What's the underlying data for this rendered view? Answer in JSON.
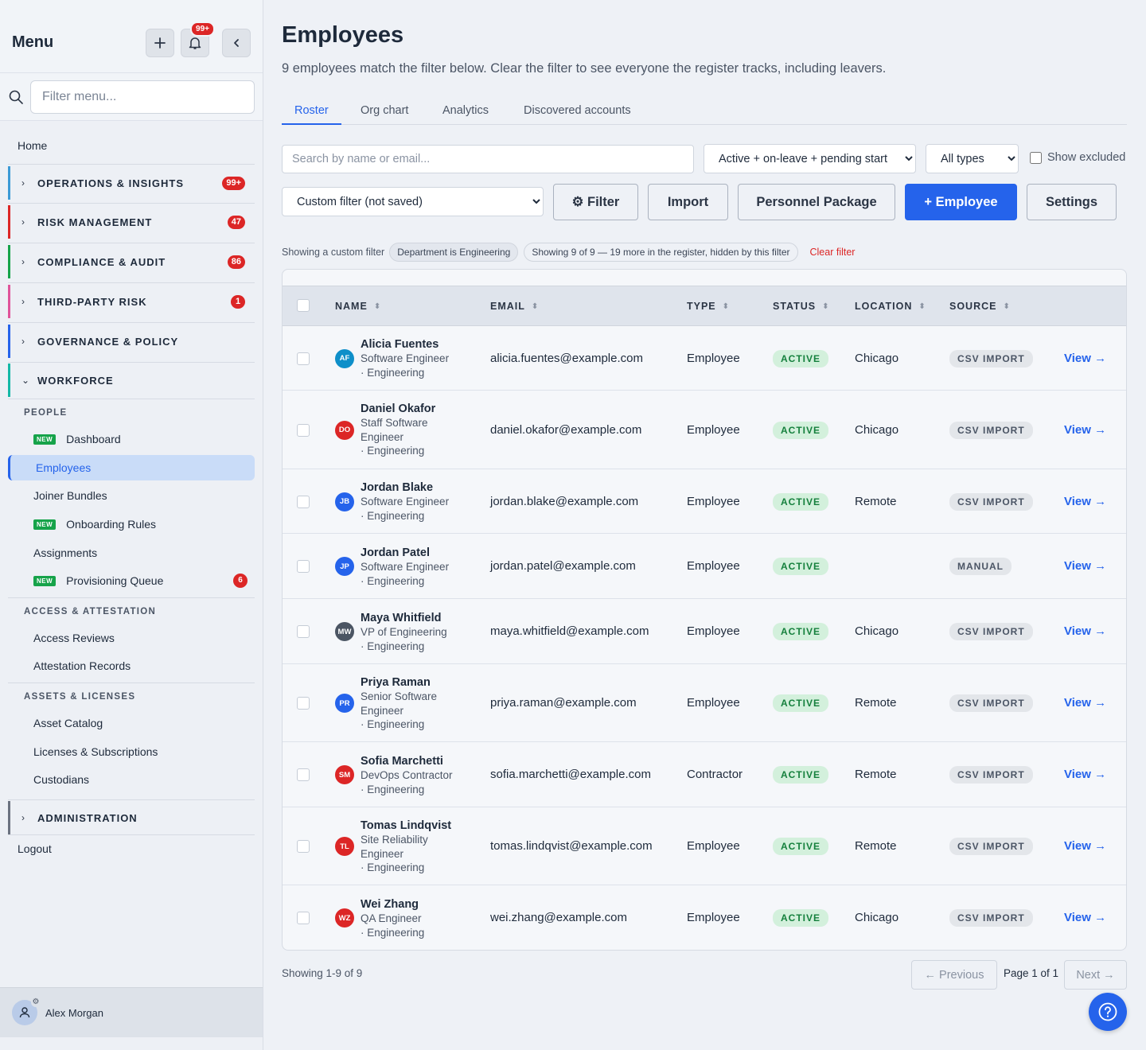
{
  "sidebar": {
    "title": "Menu",
    "notif_count": "99+",
    "search_placeholder": "Filter menu...",
    "home": "Home",
    "sections": [
      {
        "label": "OPERATIONS & INSIGHTS",
        "count": "99+",
        "color": "#3b9ad6"
      },
      {
        "label": "RISK MANAGEMENT",
        "count": "47",
        "color": "#dc2626"
      },
      {
        "label": "COMPLIANCE & AUDIT",
        "count": "86",
        "color": "#16a34a"
      },
      {
        "label": "THIRD-PARTY RISK",
        "count": "1",
        "color": "#e0549a"
      },
      {
        "label": "GOVERNANCE & POLICY",
        "count": "",
        "color": "#2563eb"
      },
      {
        "label": "WORKFORCE",
        "count": "",
        "color": "#14b8a6"
      },
      {
        "label": "ADMINISTRATION",
        "count": "",
        "color": "#6b7280"
      }
    ],
    "groups": {
      "people": "PEOPLE",
      "access": "ACCESS & ATTESTATION",
      "assets": "ASSETS & LICENSES"
    },
    "new_badge": "NEW",
    "items": {
      "dashboard": "Dashboard",
      "employees": "Employees",
      "joiner_bundles": "Joiner Bundles",
      "onboarding_rules": "Onboarding Rules",
      "assignments": "Assignments",
      "provisioning_queue": "Provisioning Queue",
      "provisioning_count": "6",
      "access_reviews": "Access Reviews",
      "attestation_records": "Attestation Records",
      "asset_catalog": "Asset Catalog",
      "licenses": "Licenses & Subscriptions",
      "custodians": "Custodians"
    },
    "logout": "Logout",
    "user_name": "Alex Morgan"
  },
  "main": {
    "title": "Employees",
    "subtitle": "9 employees match the filter below. Clear the filter to see everyone the register tracks, including leavers.",
    "tabs": [
      "Roster",
      "Org chart",
      "Analytics",
      "Discovered accounts"
    ],
    "search_placeholder": "Search by name or email...",
    "status_filter": "Active + on-leave + pending start",
    "type_filter": "All types",
    "show_excluded": "Show excluded",
    "custom_filter": "Custom filter (not saved)",
    "buttons": {
      "filter": "⚙ Filter",
      "import": "Import",
      "package": "Personnel Package",
      "add": "+ Employee",
      "settings": "Settings"
    },
    "filter_note": "Showing a custom filter",
    "filter_chip": "Department is Engineering",
    "count_chip": "Showing 9 of 9 — 19 more in the register, hidden by this filter",
    "clear_filter": "Clear filter",
    "columns": [
      "NAME",
      "EMAIL",
      "TYPE",
      "STATUS",
      "LOCATION",
      "SOURCE"
    ],
    "view_label": "View →",
    "rows": [
      {
        "initials": "AF",
        "color": "#0e8fc9",
        "name": "Alicia Fuentes",
        "title": [
          "Software Engineer",
          "· Engineering"
        ],
        "email": "alicia.fuentes@example.com",
        "type": "Employee",
        "status": "ACTIVE",
        "location": "Chicago",
        "source": "CSV IMPORT"
      },
      {
        "initials": "DO",
        "color": "#dc2626",
        "name": "Daniel Okafor",
        "title": [
          "Staff Software",
          "Engineer",
          "· Engineering"
        ],
        "email": "daniel.okafor@example.com",
        "type": "Employee",
        "status": "ACTIVE",
        "location": "Chicago",
        "source": "CSV IMPORT"
      },
      {
        "initials": "JB",
        "color": "#2563eb",
        "name": "Jordan Blake",
        "title": [
          "Software Engineer",
          "· Engineering"
        ],
        "email": "jordan.blake@example.com",
        "type": "Employee",
        "status": "ACTIVE",
        "location": "Remote",
        "source": "CSV IMPORT"
      },
      {
        "initials": "JP",
        "color": "#2563eb",
        "name": "Jordan Patel",
        "title": [
          "Software Engineer",
          "· Engineering"
        ],
        "email": "jordan.patel@example.com",
        "type": "Employee",
        "status": "ACTIVE",
        "location": "",
        "source": "MANUAL"
      },
      {
        "initials": "MW",
        "color": "#4b5563",
        "name": "Maya Whitfield",
        "title": [
          "VP of Engineering",
          "· Engineering"
        ],
        "email": "maya.whitfield@example.com",
        "type": "Employee",
        "status": "ACTIVE",
        "location": "Chicago",
        "source": "CSV IMPORT"
      },
      {
        "initials": "PR",
        "color": "#2563eb",
        "name": "Priya Raman",
        "title": [
          "Senior Software",
          "Engineer",
          "· Engineering"
        ],
        "email": "priya.raman@example.com",
        "type": "Employee",
        "status": "ACTIVE",
        "location": "Remote",
        "source": "CSV IMPORT"
      },
      {
        "initials": "SM",
        "color": "#dc2626",
        "name": "Sofia Marchetti",
        "title": [
          "DevOps Contractor",
          "· Engineering"
        ],
        "email": "sofia.marchetti@example.com",
        "type": "Contractor",
        "status": "ACTIVE",
        "location": "Remote",
        "source": "CSV IMPORT"
      },
      {
        "initials": "TL",
        "color": "#dc2626",
        "name": "Tomas Lindqvist",
        "title": [
          "Site Reliability",
          "Engineer",
          "· Engineering"
        ],
        "email": "tomas.lindqvist@example.com",
        "type": "Employee",
        "status": "ACTIVE",
        "location": "Remote",
        "source": "CSV IMPORT"
      },
      {
        "initials": "WZ",
        "color": "#dc2626",
        "name": "Wei Zhang",
        "title": [
          "QA Engineer",
          "· Engineering"
        ],
        "email": "wei.zhang@example.com",
        "type": "Employee",
        "status": "ACTIVE",
        "location": "Chicago",
        "source": "CSV IMPORT"
      }
    ],
    "footer_count": "Showing 1-9 of 9",
    "prev": "← Previous",
    "page_info": "Page 1 of 1",
    "next": "Next →"
  }
}
